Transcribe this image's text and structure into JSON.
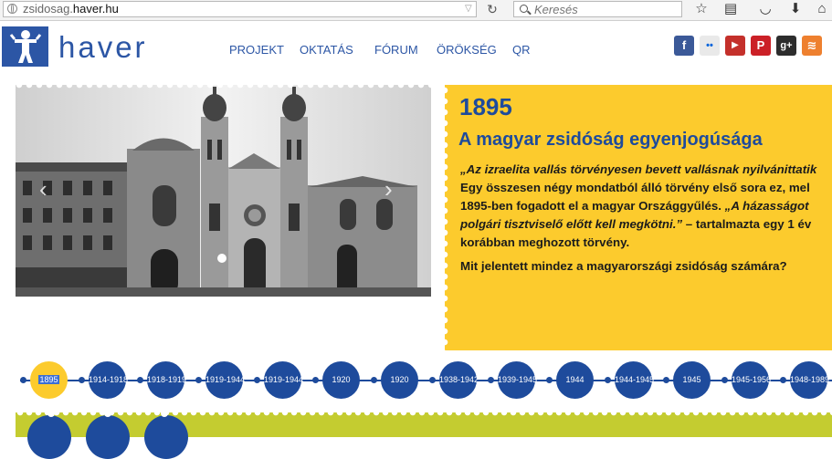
{
  "browser": {
    "url_prefix": "zsidosag.",
    "url_domain": "haver.hu",
    "search_placeholder": "Keresés"
  },
  "site": {
    "brand": "haver",
    "nav": [
      "PROJEKT",
      "OKTATÁS",
      "FÓRUM",
      "ÖRÖKSÉG",
      "QR"
    ],
    "social": [
      {
        "name": "facebook",
        "glyph": "f",
        "color": "#3b5998"
      },
      {
        "name": "flickr",
        "glyph": "••",
        "color": "#e9e9e9"
      },
      {
        "name": "youtube",
        "glyph": "▶",
        "color": "#c4302b"
      },
      {
        "name": "pinterest",
        "glyph": "P",
        "color": "#cb2027"
      },
      {
        "name": "google-plus",
        "glyph": "g+",
        "color": "#2d2d2d"
      },
      {
        "name": "rss",
        "glyph": "≋",
        "color": "#ee802f"
      }
    ]
  },
  "panel": {
    "year": "1895",
    "title": "A magyar zsidóság egyenjogúsága",
    "p_italic1": "„Az izraelita vallás törvényesen bevett vallásnak nyilvánittatik",
    "p_line2": "Egy összesen négy mondatból álló törvény első sora ez, mel",
    "p_line3a": "1895-ben fogadott el a magyar Országgyűlés. ",
    "p_italic2": "„A házasságot",
    "p_italic3": "polgári tisztviselő előtt kell megkötni.”",
    "p_line4b": " – tartalmazta egy 1 év",
    "p_line5": "korábban meghozott törvény.",
    "question": "Mit jelentett mindez a magyarországi zsidóság számára?"
  },
  "timeline": [
    "1895",
    "1914-1918",
    "1918-1919",
    "1919-1944",
    "1919-1944",
    "1920",
    "1920",
    "1938-1942",
    "1939-1945",
    "1944",
    "1944-1945",
    "1945",
    "1945-1956",
    "1948-1989"
  ],
  "colors": {
    "brand_blue": "#2c56a5",
    "panel_yellow": "#fccb2d",
    "timeline_green": "#c4cc30"
  }
}
